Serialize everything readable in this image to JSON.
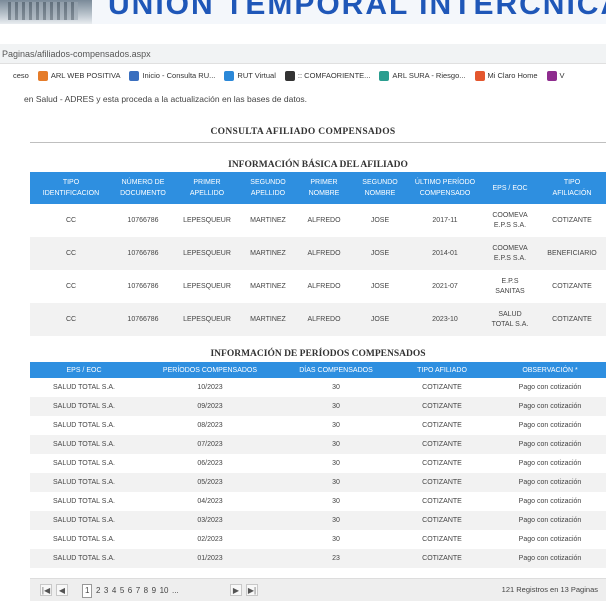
{
  "banner": {
    "title": "UNIÓN TEMPORAL INTERCNICATATOMBO"
  },
  "browser": {
    "url": "Paginas/afiliados-compensados.aspx",
    "bookmarks": [
      {
        "label": "ceso",
        "color": "#ffffff"
      },
      {
        "label": "ARL WEB POSITIVA",
        "color": "#e57c2a"
      },
      {
        "label": "Inicio - Consulta RU...",
        "color": "#3a6fbf"
      },
      {
        "label": "RUT Virtual",
        "color": "#2b88d8"
      },
      {
        "label": ":: COMFAORIENTE...",
        "color": "#333333"
      },
      {
        "label": "ARL SURA - Riesgo...",
        "color": "#2a9d8f"
      },
      {
        "label": "Mi Claro Home",
        "color": "#e4572e"
      },
      {
        "label": "V",
        "color": "#8e2c8e"
      }
    ]
  },
  "info_text": "en Salud - ADRES y esta proceda a la actualización en las bases de datos.",
  "page_title": "CONSULTA AFILIADO COMPENSADOS",
  "basic": {
    "title": "INFORMACIÓN BÁSICA DEL AFILIADO",
    "headers": [
      [
        "TIPO",
        "IDENTIFICACION"
      ],
      [
        "NÚMERO DE",
        "DOCUMENTO"
      ],
      [
        "PRIMER",
        "APELLIDO"
      ],
      [
        "SEGUNDO",
        "APELLIDO"
      ],
      [
        "PRIMER",
        "NOMBRE"
      ],
      [
        "SEGUNDO",
        "NOMBRE"
      ],
      [
        "ÚLTIMO PERÍODO",
        "COMPENSADO"
      ],
      [
        "EPS / EOC",
        ""
      ],
      [
        "TIPO",
        "AFILIACIÓN"
      ]
    ],
    "rows": [
      [
        [
          "CC"
        ],
        [
          "10766786"
        ],
        [
          "LEPESQUEUR"
        ],
        [
          "MARTINEZ"
        ],
        [
          "ALFREDO"
        ],
        [
          "JOSE"
        ],
        [
          "2017-11"
        ],
        [
          "COOMEVA",
          "E.P.S S.A."
        ],
        [
          "COTIZANTE"
        ]
      ],
      [
        [
          "CC"
        ],
        [
          "10766786"
        ],
        [
          "LEPESQUEUR"
        ],
        [
          "MARTINEZ"
        ],
        [
          "ALFREDO"
        ],
        [
          "JOSE"
        ],
        [
          "2014-01"
        ],
        [
          "COOMEVA",
          "E.P.S S.A."
        ],
        [
          "BENEFICIARIO"
        ]
      ],
      [
        [
          "CC"
        ],
        [
          "10766786"
        ],
        [
          "LEPESQUEUR"
        ],
        [
          "MARTINEZ"
        ],
        [
          "ALFREDO"
        ],
        [
          "JOSE"
        ],
        [
          "2021-07"
        ],
        [
          "E.P.S",
          "SANITAS"
        ],
        [
          "COTIZANTE"
        ]
      ],
      [
        [
          "CC"
        ],
        [
          "10766786"
        ],
        [
          "LEPESQUEUR"
        ],
        [
          "MARTINEZ"
        ],
        [
          "ALFREDO"
        ],
        [
          "JOSE"
        ],
        [
          "2023-10"
        ],
        [
          "SALUD",
          "TOTAL S.A."
        ],
        [
          "COTIZANTE"
        ]
      ]
    ]
  },
  "periods": {
    "title": "INFORMACIÓN DE PERÍODOS COMPENSADOS",
    "headers": [
      "EPS / EOC",
      "PERÍODOS COMPENSADOS",
      "DÍAS COMPENSADOS",
      "TIPO AFILIADO",
      "OBSERVACIÓN *"
    ],
    "rows": [
      [
        "SALUD TOTAL S.A.",
        "10/2023",
        "30",
        "COTIZANTE",
        "Pago con cotización"
      ],
      [
        "SALUD TOTAL S.A.",
        "09/2023",
        "30",
        "COTIZANTE",
        "Pago con cotización"
      ],
      [
        "SALUD TOTAL S.A.",
        "08/2023",
        "30",
        "COTIZANTE",
        "Pago con cotización"
      ],
      [
        "SALUD TOTAL S.A.",
        "07/2023",
        "30",
        "COTIZANTE",
        "Pago con cotización"
      ],
      [
        "SALUD TOTAL S.A.",
        "06/2023",
        "30",
        "COTIZANTE",
        "Pago con cotización"
      ],
      [
        "SALUD TOTAL S.A.",
        "05/2023",
        "30",
        "COTIZANTE",
        "Pago con cotización"
      ],
      [
        "SALUD TOTAL S.A.",
        "04/2023",
        "30",
        "COTIZANTE",
        "Pago con cotización"
      ],
      [
        "SALUD TOTAL S.A.",
        "03/2023",
        "30",
        "COTIZANTE",
        "Pago con cotización"
      ],
      [
        "SALUD TOTAL S.A.",
        "02/2023",
        "30",
        "COTIZANTE",
        "Pago con cotización"
      ],
      [
        "SALUD TOTAL S.A.",
        "01/2023",
        "23",
        "COTIZANTE",
        "Pago con cotización"
      ]
    ]
  },
  "pager": {
    "first": "|◀",
    "prev": "◀",
    "next": "▶",
    "last": "▶|",
    "pages": [
      "1",
      "2",
      "3",
      "4",
      "5",
      "6",
      "7",
      "8",
      "9",
      "10",
      "..."
    ],
    "current": "1",
    "records": "121 Registros en 13 Paginas"
  }
}
